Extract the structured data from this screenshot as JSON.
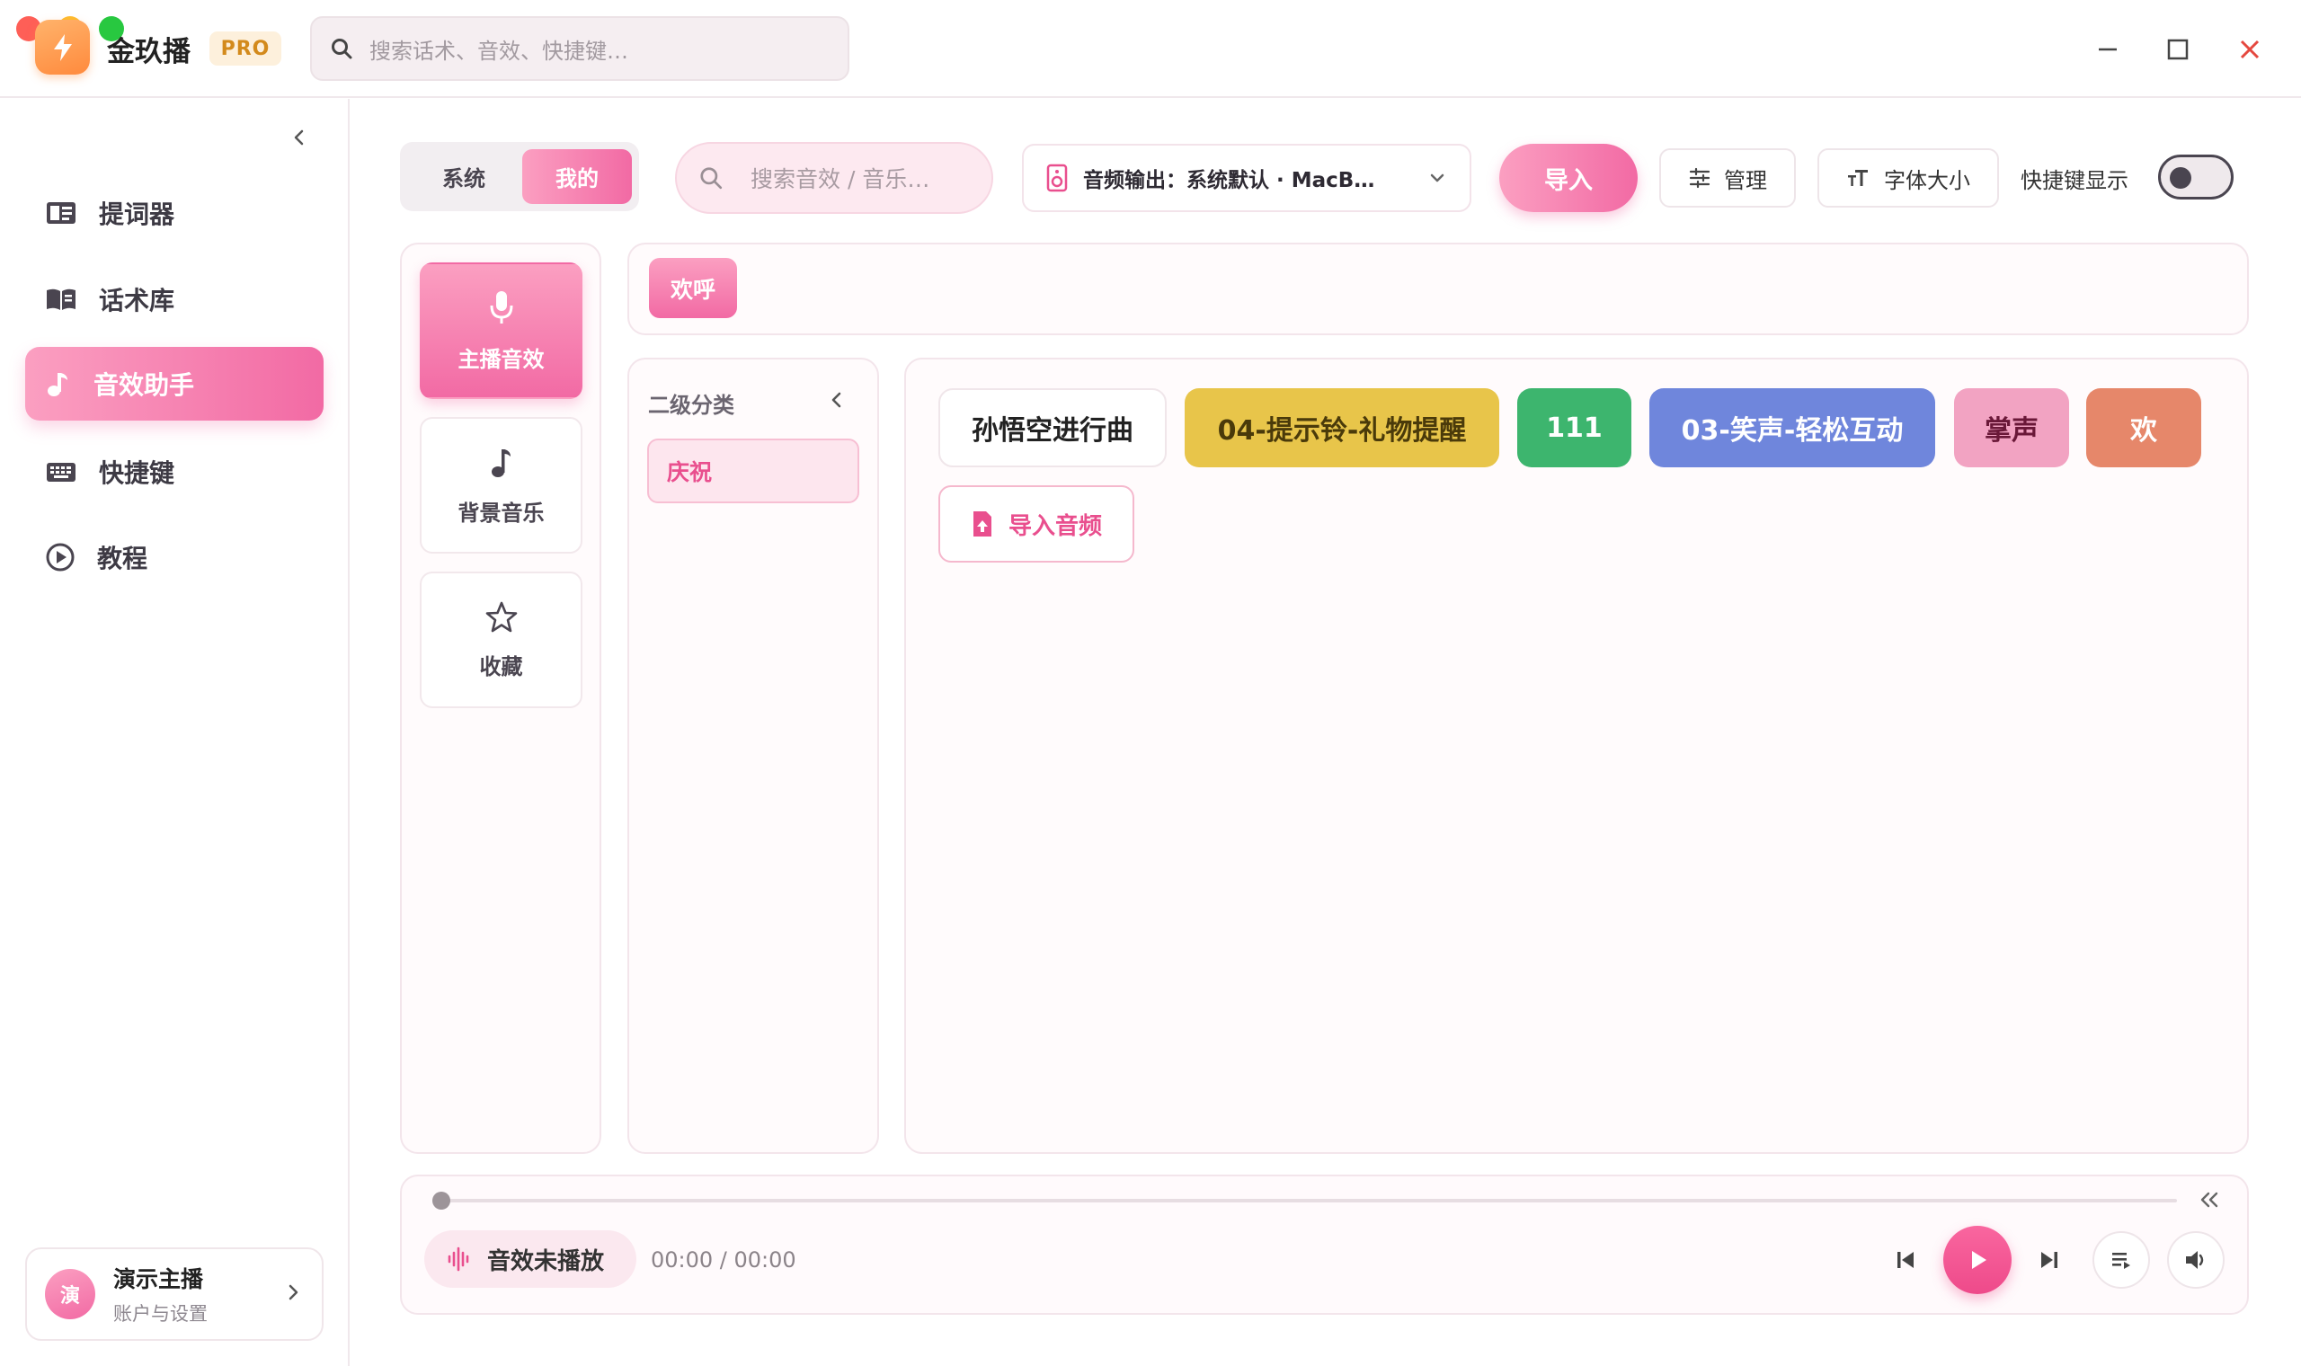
{
  "app": {
    "name": "金玖播",
    "badge": "PRO",
    "search_placeholder": "搜索话术、音效、快捷键…"
  },
  "colors": {
    "accent": "#f26aa4",
    "accent_light": "#fb9fc1",
    "close": "#e5483f"
  },
  "sidebar": {
    "items": [
      {
        "label": "提词器",
        "icon": "teleprompter-icon",
        "active": false
      },
      {
        "label": "话术库",
        "icon": "book-icon",
        "active": false
      },
      {
        "label": "音效助手",
        "icon": "music-note-icon",
        "active": true
      },
      {
        "label": "快捷键",
        "icon": "keyboard-icon",
        "active": false
      },
      {
        "label": "教程",
        "icon": "play-circle-icon",
        "active": false
      }
    ],
    "user": {
      "avatar": "演",
      "name": "演示主播",
      "subtitle": "账户与设置"
    }
  },
  "toolbar": {
    "tabs": [
      "系统",
      "我的"
    ],
    "active_tab": "我的",
    "search_placeholder": "搜索音效 / 音乐…",
    "audio_output": "音频输出：系统默认 · MacB…",
    "import": "导入",
    "manage": "管理",
    "font_size": "字体大小",
    "quick_display": "快捷键显示",
    "quick_display_on": false
  },
  "categories": [
    {
      "label": "主播音效",
      "icon": "microphone-icon",
      "active": true
    },
    {
      "label": "背景音乐",
      "icon": "music-note-icon",
      "active": false
    },
    {
      "label": "收藏",
      "icon": "star-icon",
      "active": false
    }
  ],
  "tags": [
    "欢呼"
  ],
  "subcategory": {
    "title": "二级分类",
    "items": [
      "庆祝"
    ]
  },
  "sounds": [
    {
      "label": "孙悟空进行曲",
      "bg": "#ffffff",
      "fg": "#222222"
    },
    {
      "label": "04-提示铃-礼物提醒",
      "bg": "#e8c54a",
      "fg": "#4a3a0a"
    },
    {
      "label": "111",
      "bg": "#3db56e",
      "fg": "#ffffff"
    },
    {
      "label": "03-笑声-轻松互动",
      "bg": "#6f86dc",
      "fg": "#ffffff"
    },
    {
      "label": "掌声",
      "bg": "#f2a3c2",
      "fg": "#6a1838"
    },
    {
      "label": "欢",
      "bg": "#e6876a",
      "fg": "#ffffff"
    }
  ],
  "import_audio": "导入音频",
  "player": {
    "status": "音效未播放",
    "time": "00:00 / 00:00",
    "progress": 0
  }
}
